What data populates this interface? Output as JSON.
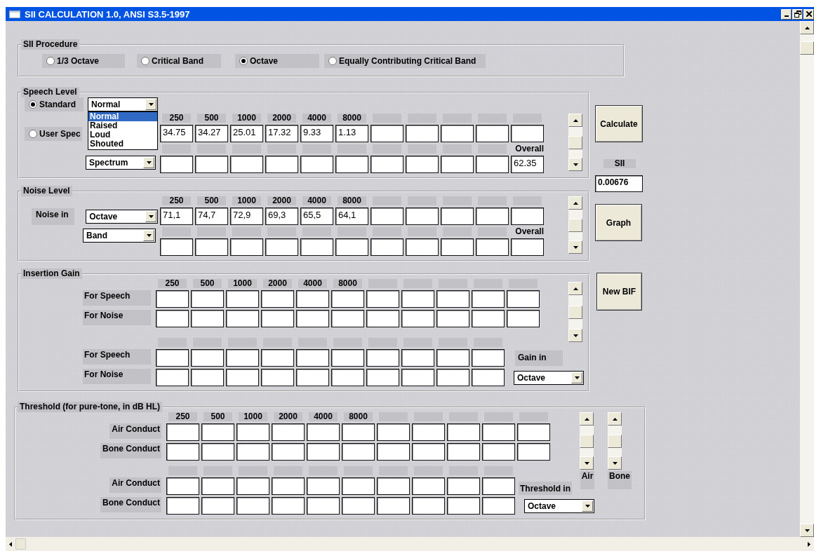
{
  "window": {
    "title": "SII CALCULATION 1.0, ANSI S3.5-1997"
  },
  "procedure": {
    "title": "SII Procedure",
    "options": [
      {
        "label": "1/3 Octave",
        "selected": false
      },
      {
        "label": "Critical Band",
        "selected": false
      },
      {
        "label": "Octave",
        "selected": true
      },
      {
        "label": "Equally Contributing Critical Band",
        "selected": false
      }
    ]
  },
  "speech_level": {
    "title": "Speech Level",
    "modes": [
      {
        "label": "Standard",
        "selected": true
      },
      {
        "label": "User Spec",
        "selected": false
      }
    ],
    "level_dropdown": {
      "value": "Normal",
      "expanded": true,
      "options": [
        {
          "label": "Normal",
          "selected": true
        },
        {
          "label": "Raised",
          "selected": false
        },
        {
          "label": "Loud",
          "selected": false
        },
        {
          "label": "Shouted",
          "selected": false
        }
      ]
    },
    "type_dropdown": {
      "value": "Spectrum"
    },
    "frequencies": [
      "250",
      "500",
      "1000",
      "2000",
      "4000",
      "8000"
    ],
    "levels": [
      "34.75",
      "34.27",
      "25.01",
      "17.32",
      "9.33",
      "1.13"
    ],
    "overall_label": "Overall",
    "overall": "62.35"
  },
  "noise_level": {
    "title": "Noise Level",
    "noise_in_label": "Noise in",
    "unit_dropdown": {
      "value": "Octave"
    },
    "type_dropdown": {
      "value": "Band"
    },
    "frequencies": [
      "250",
      "500",
      "1000",
      "2000",
      "4000",
      "8000"
    ],
    "levels": [
      "71,1",
      "74,7",
      "72,9",
      "69,3",
      "65,5",
      "64,1"
    ],
    "overall_label": "Overall"
  },
  "insertion_gain": {
    "title": "Insertion Gain",
    "frequencies": [
      "250",
      "500",
      "1000",
      "2000",
      "4000",
      "8000"
    ],
    "rows": [
      {
        "label": "For Speech"
      },
      {
        "label": "For Noise"
      }
    ],
    "rows_lower": [
      {
        "label": "For Speech"
      },
      {
        "label": "For Noise"
      }
    ],
    "gain_in_label": "Gain in",
    "gain_in_dropdown": {
      "value": "Octave"
    }
  },
  "threshold": {
    "title": "Threshold (for pure-tone, in dB HL)",
    "frequencies": [
      "250",
      "500",
      "1000",
      "2000",
      "4000",
      "8000"
    ],
    "rows": [
      {
        "label": "Air Conduct"
      },
      {
        "label": "Bone Conduct"
      }
    ],
    "rows_lower": [
      {
        "label": "Air Conduct"
      },
      {
        "label": "Bone Conduct"
      }
    ],
    "threshold_in_label": "Threshold in",
    "threshold_in_dropdown": {
      "value": "Octave"
    },
    "scrollbar_labels": [
      "Air",
      "Bone"
    ]
  },
  "side": {
    "calculate": "Calculate",
    "sii_label": "SII",
    "sii_value": "0.00676",
    "graph": "Graph",
    "new_bif": "New BIF"
  }
}
